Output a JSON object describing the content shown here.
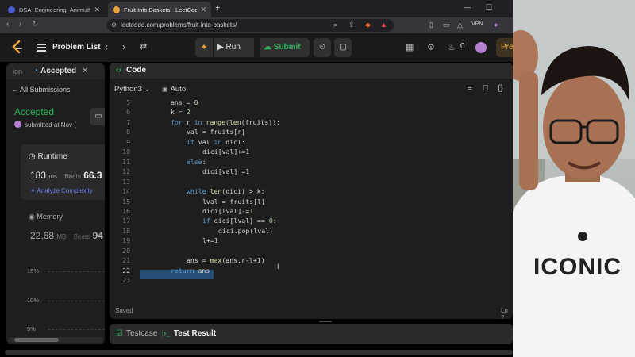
{
  "browser": {
    "tabs": [
      {
        "title": "DSA_Engineering_Animuthyam_pyt"
      },
      {
        "title": "Fruit Into Baskets - LeetCode"
      }
    ],
    "url": "leetcode.com/problems/fruit-into-baskets/",
    "vpn_label": "VPN"
  },
  "nav": {
    "problem_list": "Problem List",
    "run": "Run",
    "submit": "Submit",
    "fire_count": "0",
    "premium": "Pre"
  },
  "left": {
    "tab_prev": "ion",
    "tab_active": "Accepted",
    "all_submissions": "All Submissions",
    "status": "Accepted",
    "submitted_at": "submitted at Nov (",
    "runtime": {
      "title": "Runtime",
      "value": "183",
      "unit": "ms",
      "beats_label": "Beats",
      "beats": "66.3"
    },
    "analyze": "Analyze Complexity",
    "memory": {
      "title": "Memory",
      "value": "22.68",
      "unit": "MB",
      "beats_label": "Beats",
      "beats": "94"
    },
    "y_ticks": [
      "15%",
      "10%",
      "5%"
    ]
  },
  "code_panel": {
    "title": "Code",
    "language": "Python3",
    "mode": "Auto",
    "saved": "Saved",
    "line_col": "Ln 2",
    "lines": [
      {
        "n": "5",
        "text": "ans = 0"
      },
      {
        "n": "6",
        "text": "k = 2"
      },
      {
        "n": "7",
        "text": "for r in range(len(fruits)):"
      },
      {
        "n": "8",
        "text": "val = fruits[r]"
      },
      {
        "n": "9",
        "text": "if val in dici:"
      },
      {
        "n": "10",
        "text": "dici[val]+=1"
      },
      {
        "n": "11",
        "text": "else:"
      },
      {
        "n": "12",
        "text": "dici[val] =1"
      },
      {
        "n": "13",
        "text": ""
      },
      {
        "n": "14",
        "text": "while len(dici) > k:"
      },
      {
        "n": "15",
        "text": "lval = fruits[l]"
      },
      {
        "n": "16",
        "text": "dici[lval]-=1"
      },
      {
        "n": "17",
        "text": "if dici[lval] == 0:"
      },
      {
        "n": "18",
        "text": "dici.pop(lval)"
      },
      {
        "n": "19",
        "text": "l+=1"
      },
      {
        "n": "20",
        "text": ""
      },
      {
        "n": "21",
        "text": "ans = max(ans,r-l+1)"
      },
      {
        "n": "22",
        "text": "return ans"
      },
      {
        "n": "23",
        "text": ""
      }
    ]
  },
  "bottom": {
    "testcase": "Testcase",
    "test_result": "Test Result"
  },
  "webcam": {
    "shirt_text": "ICONIC"
  },
  "colors": {
    "accent_green": "#2db55d",
    "bg": "#1a1a1a",
    "panel": "#1e1e1e",
    "selection": "#264f78"
  }
}
